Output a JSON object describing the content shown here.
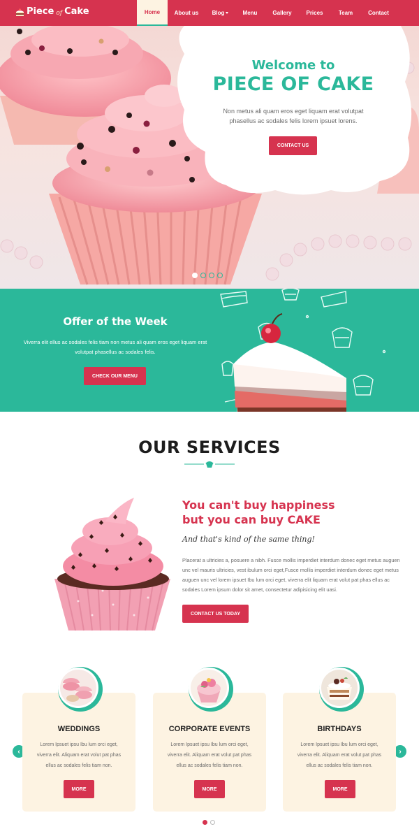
{
  "nav": {
    "logo": {
      "part1": "Piece",
      "part2": "of",
      "part3": "Cake"
    },
    "items": [
      {
        "label": "Home",
        "active": true
      },
      {
        "label": "About us",
        "active": false
      },
      {
        "label": "Blog",
        "active": false,
        "dropdown": true
      },
      {
        "label": "Menu",
        "active": false
      },
      {
        "label": "Gallery",
        "active": false
      },
      {
        "label": "Prices",
        "active": false
      },
      {
        "label": "Team",
        "active": false
      },
      {
        "label": "Contact",
        "active": false
      }
    ]
  },
  "hero": {
    "title_line1": "Welcome to",
    "title_line2": "PIECE OF CAKE",
    "text": "Non metus ali quam eros eget liquam erat volutpat phasellus ac sodales felis lorem ipsuet lorens.",
    "button": "CONTACT US",
    "slides": 4,
    "active_slide": 1
  },
  "offer": {
    "title": "Offer of the Week",
    "text": "Viverra elit ellus ac sodales felis tiam non metus ali quam eros eget liquam erat volutpat phasellus ac sodales felis.",
    "button": "CHECK OUR MENU"
  },
  "services": {
    "title": "OUR SERVICES",
    "tagline_line1": "You can't buy happiness",
    "tagline_line2": "but you can buy CAKE",
    "subtagline": "And that's kind of the same thing!",
    "text": "Placerat a ultricies a, posuere a nibh. Fusce mollis imperdiet interdum donec eget metus auguen unc vel mauris ultricies, vest ibulum orci eget,Fusce mollis imperdiet interdum donec eget metus auguen unc vel lorem ipsuet Ibu lum orci eget, viverra elit liquam erat volut pat phas ellus ac sodales Lorem ipsum dolor sit amet, consectetur adipisicing elit uasi.",
    "button": "CONTACT US TODAY",
    "cards": [
      {
        "title": "WEDDINGS",
        "text": "Lorem Ipsuet ipsu Ibu lum orci eget, viverra elit. Aliquam erat volut pat phas ellus ac sodales felis tiam non.",
        "button": "MORE"
      },
      {
        "title": "CORPORATE EVENTS",
        "text": "Lorem Ipsuet ipsu Ibu lum orci eget, viverra elit. Aliquam erat volut pat phas ellus ac sodales felis tiam non.",
        "button": "MORE"
      },
      {
        "title": "BIRTHDAYS",
        "text": "Lorem Ipsuet ipsu Ibu lum orci eget, viverra elit. Aliquam erat volut pat phas ellus ac sodales felis tiam non.",
        "button": "MORE"
      }
    ],
    "prev_arrow": "‹",
    "next_arrow": "›",
    "pages": 2,
    "active_page": 1
  },
  "colors": {
    "primary": "#d6334f",
    "accent": "#2bb89a",
    "cream": "#fdf3e2"
  },
  "icons": [
    "cake-slice-icon",
    "caret-down-icon",
    "cupcake-icon",
    "chevron-left-icon",
    "chevron-right-icon"
  ]
}
